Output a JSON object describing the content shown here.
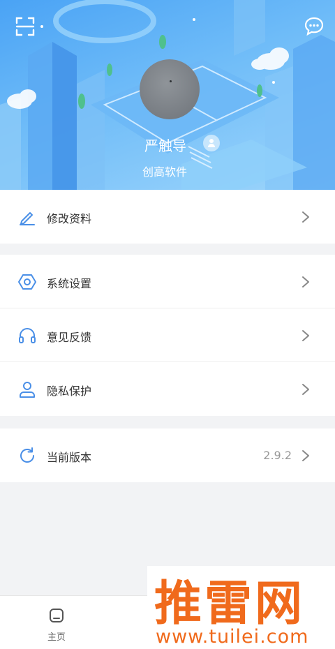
{
  "header": {
    "username": "严触导",
    "company": "创高软件",
    "scan_icon": "scan-icon",
    "message_icon": "chat-bubble-icon"
  },
  "menu_group_1": [
    {
      "label": "修改资料",
      "icon": "edit-pencil-icon"
    }
  ],
  "menu_group_2": [
    {
      "label": "系统设置",
      "icon": "settings-hexagon-icon"
    },
    {
      "label": "意见反馈",
      "icon": "headset-icon"
    },
    {
      "label": "隐私保护",
      "icon": "user-icon"
    }
  ],
  "menu_group_3": [
    {
      "label": "当前版本",
      "value": "2.9.2",
      "icon": "refresh-icon"
    }
  ],
  "tabbar": {
    "home_label": "主页"
  },
  "watermark": {
    "title": "推雷网",
    "url": "www.tuilei.com"
  },
  "colors": {
    "accent": "#4a8fe7",
    "hero_sky": "#6fbcf8",
    "watermark": "#f06a1c"
  }
}
